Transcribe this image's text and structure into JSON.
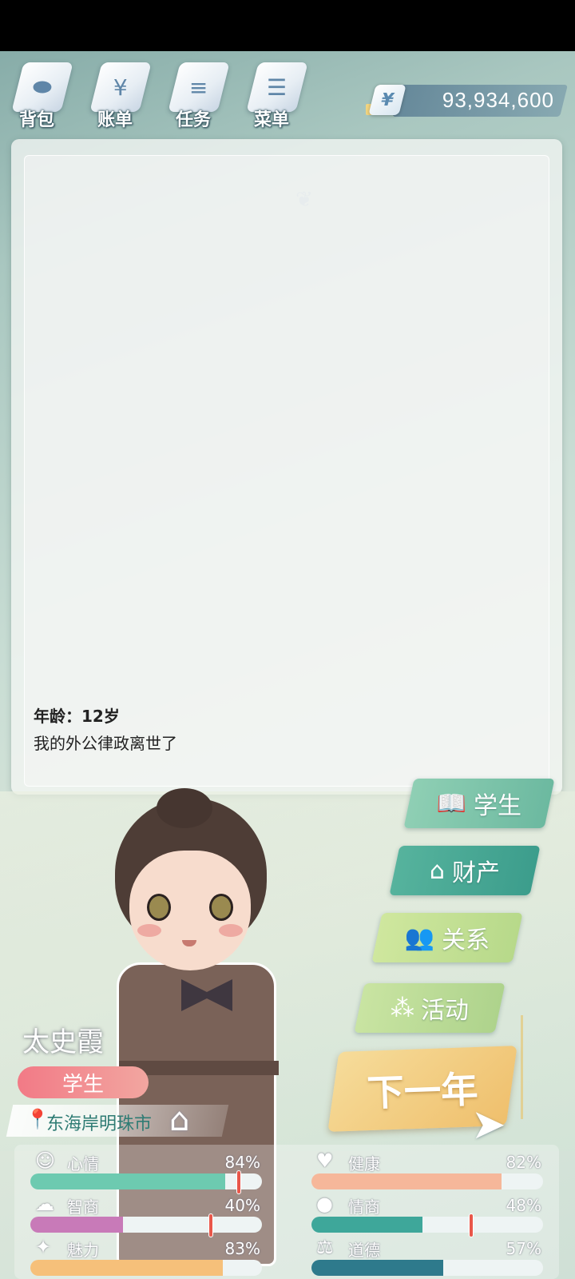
{
  "topnav": {
    "items": [
      {
        "label": "背包",
        "icon": "bag-icon"
      },
      {
        "label": "账单",
        "icon": "bill-icon"
      },
      {
        "label": "任务",
        "icon": "task-icon"
      },
      {
        "label": "菜单",
        "icon": "menu-icon"
      }
    ],
    "money_symbol": "¥",
    "money": "93,934,600"
  },
  "event": {
    "age": "年龄：12岁",
    "text": "我的外公律政离世了"
  },
  "roles": {
    "student": "学生",
    "assets": "财产",
    "relations": "关系",
    "activities": "活动"
  },
  "next_year": "下一年",
  "profile": {
    "name": "太史霞",
    "job": "学生",
    "location": "东海岸明珠市"
  },
  "stats": [
    {
      "name": "心情",
      "value": 84,
      "label": "84%",
      "icon": "smile-icon",
      "color": "#6dcab0",
      "threshold": 90
    },
    {
      "name": "健康",
      "value": 82,
      "label": "82%",
      "icon": "heart-icon",
      "color": "#f6b79a",
      "threshold": null
    },
    {
      "name": "智商",
      "value": 40,
      "label": "40%",
      "icon": "brain-icon",
      "color": "#c87ab8",
      "threshold": 78
    },
    {
      "name": "情商",
      "value": 48,
      "label": "48%",
      "icon": "apple-icon",
      "color": "#3ea79a",
      "threshold": 69
    },
    {
      "name": "魅力",
      "value": 83,
      "label": "83%",
      "icon": "sparkle-icon",
      "color": "#f6c07a",
      "threshold": null
    },
    {
      "name": "道德",
      "value": 57,
      "label": "57%",
      "icon": "scale-icon",
      "color": "#2e7a8c",
      "threshold": null
    }
  ]
}
